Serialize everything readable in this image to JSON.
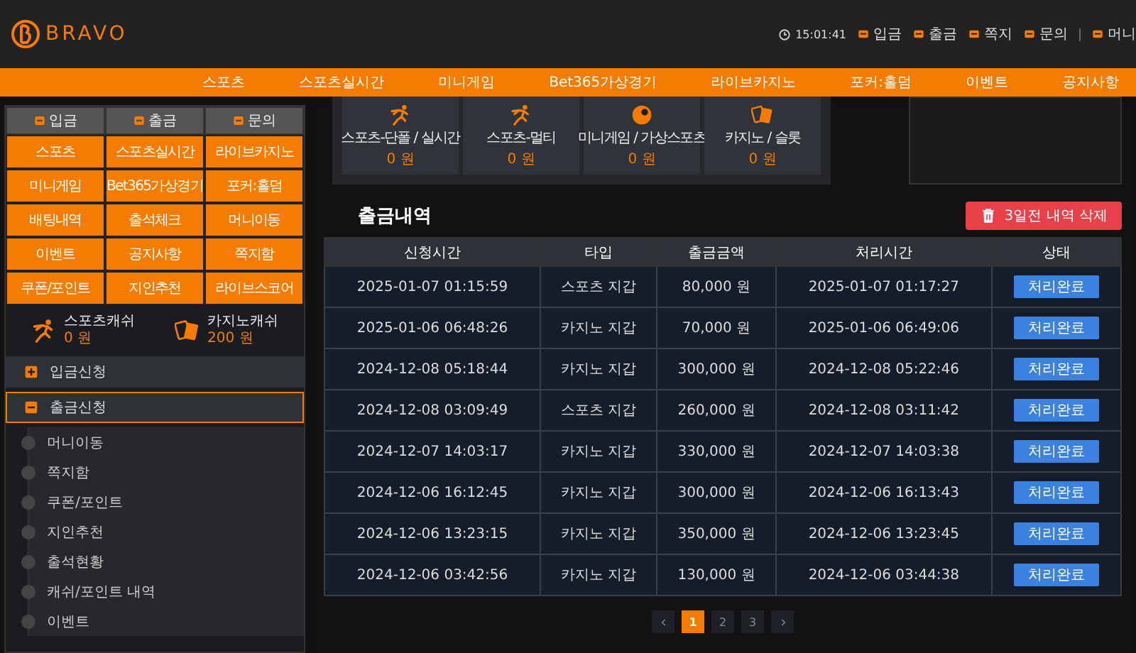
{
  "header": {
    "logo": "BRAVO",
    "time": "15:01:41",
    "links": [
      "입금",
      "출금",
      "쪽지",
      "문의",
      "머니"
    ]
  },
  "nav": [
    "스포츠",
    "스포츠실시간",
    "미니게임",
    "Bet365가상경기",
    "라이브카지노",
    "포커:홀덤",
    "이벤트",
    "공지사항"
  ],
  "sidebar": {
    "tabs": [
      "입금",
      "출금",
      "문의"
    ],
    "grid": [
      "스포츠",
      "스포츠실시간",
      "라이브카지노",
      "미니게임",
      "Bet365가상경기",
      "포커:홀덤",
      "배팅내역",
      "출석체크",
      "머니이동",
      "이벤트",
      "공지사항",
      "쪽지함",
      "쿠폰/포인트",
      "지인추천",
      "라이브스코어"
    ],
    "cash": [
      {
        "kind": "runner",
        "label": "스포츠캐쉬",
        "amount": "0 원"
      },
      {
        "kind": "cards",
        "label": "카지노캐쉬",
        "amount": "200 원"
      }
    ],
    "menu": [
      {
        "label": "입금신청",
        "expanded": false,
        "selected": false
      },
      {
        "label": "출금신청",
        "expanded": true,
        "selected": true,
        "children": [
          "머니이동",
          "쪽지함",
          "쿠폰/포인트",
          "지인추천",
          "출석현황",
          "캐쉬/포인트 내역",
          "이벤트"
        ]
      }
    ]
  },
  "wallets": [
    {
      "kind": "runner",
      "label": "스포츠-단폴 / 실시간",
      "amount": "0 원"
    },
    {
      "kind": "runner",
      "label": "스포츠-멀티",
      "amount": "0 원"
    },
    {
      "kind": "ball",
      "label": "미니게임 / 가상스포츠",
      "amount": "0 원"
    },
    {
      "kind": "cards",
      "label": "카지노 / 슬롯",
      "amount": "0 원"
    }
  ],
  "history": {
    "title": "출금내역",
    "delete_button": "3일전 내역 삭제",
    "columns": [
      "신청시간",
      "타입",
      "출금금액",
      "처리시간",
      "상태"
    ],
    "rows": [
      {
        "requested": "2025-01-07 01:15:59",
        "type": "스포츠 지갑",
        "amount": "80,000 원",
        "processed": "2025-01-07 01:17:27",
        "status": "처리완료"
      },
      {
        "requested": "2025-01-06 06:48:26",
        "type": "카지노 지갑",
        "amount": "70,000 원",
        "processed": "2025-01-06 06:49:06",
        "status": "처리완료"
      },
      {
        "requested": "2024-12-08 05:18:44",
        "type": "카지노 지갑",
        "amount": "300,000 원",
        "processed": "2024-12-08 05:22:46",
        "status": "처리완료"
      },
      {
        "requested": "2024-12-08 03:09:49",
        "type": "스포츠 지갑",
        "amount": "260,000 원",
        "processed": "2024-12-08 03:11:42",
        "status": "처리완료"
      },
      {
        "requested": "2024-12-07 14:03:17",
        "type": "카지노 지갑",
        "amount": "330,000 원",
        "processed": "2024-12-07 14:03:38",
        "status": "처리완료"
      },
      {
        "requested": "2024-12-06 16:12:45",
        "type": "카지노 지갑",
        "amount": "300,000 원",
        "processed": "2024-12-06 16:13:43",
        "status": "처리완료"
      },
      {
        "requested": "2024-12-06 13:23:15",
        "type": "카지노 지갑",
        "amount": "350,000 원",
        "processed": "2024-12-06 13:23:45",
        "status": "처리완료"
      },
      {
        "requested": "2024-12-06 03:42:56",
        "type": "카지노 지갑",
        "amount": "130,000 원",
        "processed": "2024-12-06 03:44:38",
        "status": "처리완료"
      }
    ],
    "pages": [
      {
        "label": "1",
        "selected": true
      },
      {
        "label": "2",
        "selected": false
      },
      {
        "label": "3",
        "selected": false
      }
    ]
  }
}
